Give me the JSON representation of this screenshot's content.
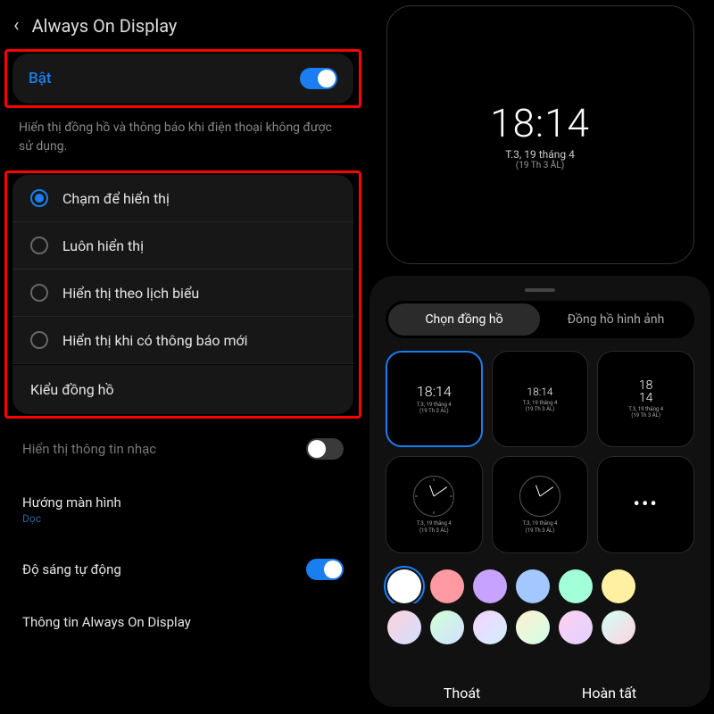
{
  "header": {
    "title": "Always On Display"
  },
  "main_toggle": {
    "label": "Bật",
    "on": true
  },
  "description": "Hiển thị đồng hồ và thông báo khi điện thoại không được sử dụng.",
  "display_modes": [
    {
      "label": "Chạm để hiển thị",
      "checked": true
    },
    {
      "label": "Luôn hiển thị",
      "checked": false
    },
    {
      "label": "Hiển thị theo lịch biểu",
      "checked": false
    },
    {
      "label": "Hiển thị khi có thông báo mới",
      "checked": false
    }
  ],
  "clock_style_label": "Kiểu đồng hồ",
  "settings": {
    "music_info": {
      "label": "Hiển thị thông tin nhạc",
      "on": false
    },
    "orientation": {
      "label": "Hướng màn hình",
      "value": "Dọc"
    },
    "auto_brightness": {
      "label": "Độ sáng tự động",
      "on": true
    },
    "about": {
      "label": "Thông tin Always On Display"
    }
  },
  "preview": {
    "time": "18:14",
    "date_line1": "T.3, 19 tháng 4",
    "date_line2": "(19 Th 3 ÂL)"
  },
  "sheet": {
    "tabs": {
      "clock": "Chọn đồng hồ",
      "image": "Đồng hồ hình ảnh"
    },
    "styles": [
      {
        "type": "digital-big",
        "time": "18:14",
        "date1": "T.3, 19 tháng 4",
        "date2": "(19 Th 3 ÂL)",
        "selected": true
      },
      {
        "type": "digital-small",
        "time": "18:14",
        "date1": "T.3, 19 tháng 4",
        "date2": "(19 Th 3 ÂL)"
      },
      {
        "type": "digital-split",
        "h": "18",
        "m": "14",
        "date1": "T.3, 19 tháng 4",
        "date2": "(19 Th 3 ÂL)"
      },
      {
        "type": "analog-marks",
        "date1": "T.3, 19 tháng 4",
        "date2": "(19 Th 3 ÂL)"
      },
      {
        "type": "analog-plain",
        "date1": "T.3, 19 tháng 4",
        "date2": "(19 Th 3 ÂL)"
      },
      {
        "type": "more"
      }
    ],
    "colors": [
      "#ffffff",
      "#ff9aa2",
      "#c8a2ff",
      "#a2c8ff",
      "#a2ffd8",
      "#fff0a2",
      "linear-gradient(135deg,#ffd1dc,#d1e0ff)",
      "linear-gradient(135deg,#d1ffd6,#d1e0ff)",
      "linear-gradient(135deg,#f5d1ff,#d1f0ff)",
      "linear-gradient(135deg,#fff0d1,#d1ffe8)",
      "linear-gradient(135deg,#ffd1f0,#e0d1ff)",
      "linear-gradient(135deg,#d1fff5,#ffd1e0)"
    ],
    "selected_color_index": 0
  },
  "actions": {
    "exit": "Thoát",
    "done": "Hoàn tất"
  }
}
